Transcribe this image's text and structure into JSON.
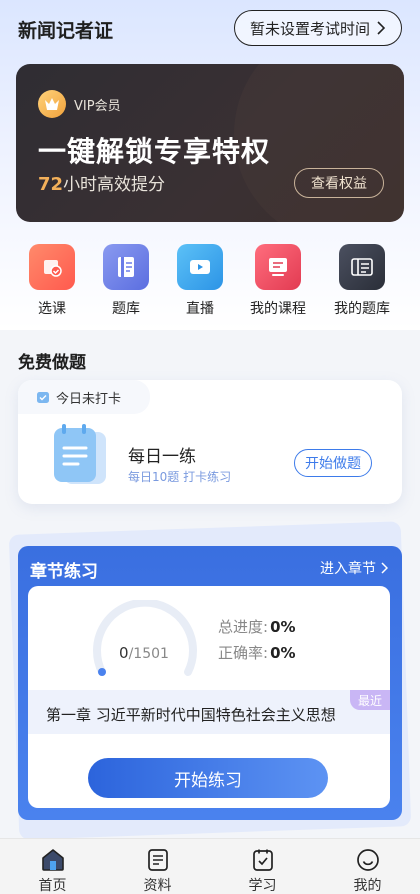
{
  "header": {
    "app_title": "新闻记者证",
    "exam_button": "暂未设置考试时间",
    "exam_button_icon": "chevron-right-icon"
  },
  "vip_banner": {
    "label": "VIP会员",
    "headline": "一键解锁专享特权",
    "sub_number": "72",
    "sub_text": "小时高效提分",
    "button": "查看权益",
    "accent_color": "#f3b05a"
  },
  "quick_actions": [
    {
      "label": "选课",
      "icon": "course-select-icon",
      "color": "#ff6d5a"
    },
    {
      "label": "题库",
      "icon": "question-bank-icon",
      "color": "#6b7de8"
    },
    {
      "label": "直播",
      "icon": "live-video-icon",
      "color": "#3aa8ef"
    },
    {
      "label": "我的课程",
      "icon": "my-course-icon",
      "color": "#ef4e63"
    },
    {
      "label": "我的题库",
      "icon": "my-bank-icon",
      "color": "#3a3f4b"
    }
  ],
  "free_practice": {
    "section_title": "免费做题",
    "checkin_tag": "今日未打卡",
    "title": "每日一练",
    "subtitle": "每日10题 打卡练习",
    "button": "开始做题"
  },
  "chapter": {
    "title": "章节练习",
    "enter_link": "进入章节",
    "progress_done": "0",
    "progress_total": "/1501",
    "progress_fraction": 0,
    "total_progress_label": "总进度:",
    "total_progress_value": "0%",
    "accuracy_label": "正确率:",
    "accuracy_value": "0%",
    "current_chapter": "第一章 习近平新时代中国特色社会主义思想",
    "recent_badge": "最近",
    "start_button": "开始练习"
  },
  "tabbar": [
    {
      "label": "首页",
      "icon": "home-icon",
      "active": true
    },
    {
      "label": "资料",
      "icon": "document-icon",
      "active": false
    },
    {
      "label": "学习",
      "icon": "study-check-icon",
      "active": false
    },
    {
      "label": "我的",
      "icon": "profile-smile-icon",
      "active": false
    }
  ]
}
